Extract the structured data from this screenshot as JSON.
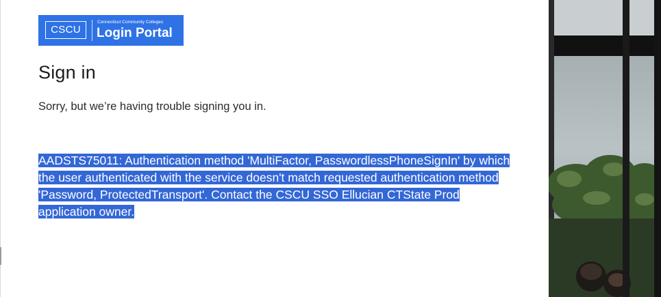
{
  "logo": {
    "short": "CSCU",
    "subtitle": "Connecticut Community Colleges",
    "title": "Login Portal"
  },
  "heading": "Sign in",
  "message": "Sorry, but we’re having trouble signing you in.",
  "error_text": "AADSTS75011: Authentication method 'MultiFactor, PasswordlessPhoneSignIn' by which the user authenticated with the service doesn't match requested authentication method 'Password, ProtectedTransport'. Contact the CSCU SSO Ellucian CTState Prod application owner.",
  "colors": {
    "brand_blue": "#2f72e6",
    "selection_blue": "#3367d6"
  }
}
